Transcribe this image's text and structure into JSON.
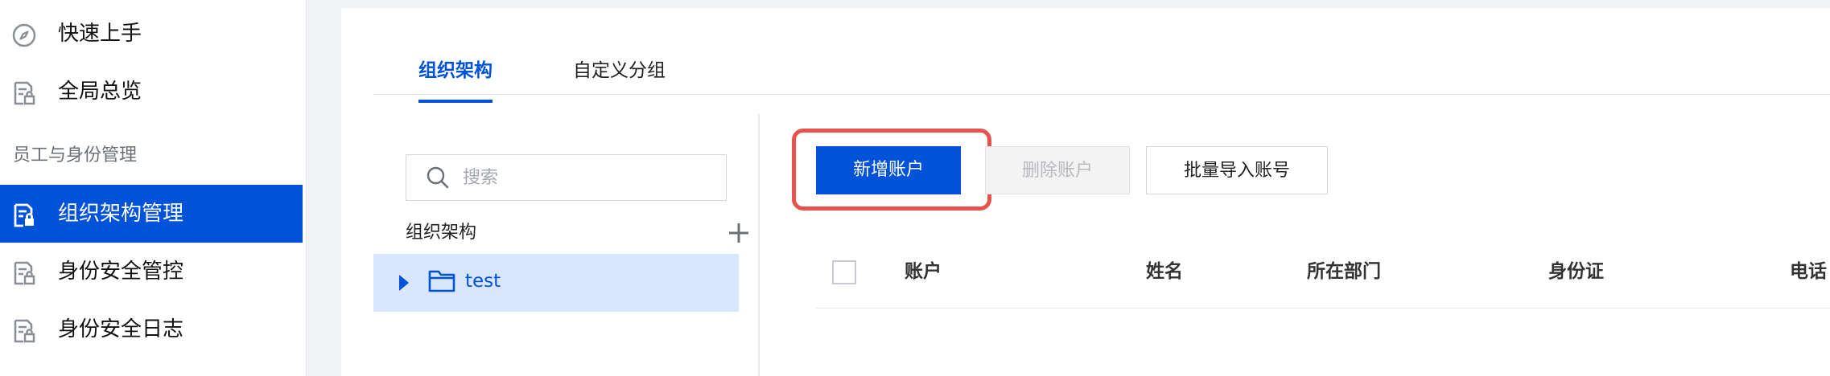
{
  "sidebar": {
    "items": [
      {
        "label": "快速上手",
        "icon": "compass-icon"
      },
      {
        "label": "全局总览",
        "icon": "doc-lock-icon"
      },
      {
        "label": "组织架构管理",
        "icon": "doc-lock-icon",
        "active": true
      },
      {
        "label": "身份安全管控",
        "icon": "doc-lock-icon"
      },
      {
        "label": "身份安全日志",
        "icon": "doc-lock-icon"
      }
    ],
    "section_label": "员工与身份管理"
  },
  "tabs": [
    {
      "label": "组织架构",
      "active": true
    },
    {
      "label": "自定义分组",
      "active": false
    }
  ],
  "tree": {
    "search_placeholder": "搜索",
    "header": "组织架构",
    "add_icon": "plus-icon",
    "nodes": [
      {
        "name": "test",
        "icon": "folder-icon",
        "collapsed": true
      }
    ]
  },
  "toolbar": {
    "add_account": "新增账户",
    "delete_account": "删除账户",
    "batch_import": "批量导入账号"
  },
  "table": {
    "columns": [
      "账户",
      "姓名",
      "所在部门",
      "身份证",
      "电话"
    ]
  },
  "colors": {
    "primary": "#0052d9",
    "highlight": "#e8524c",
    "selected_bg": "#d8e6fe"
  }
}
